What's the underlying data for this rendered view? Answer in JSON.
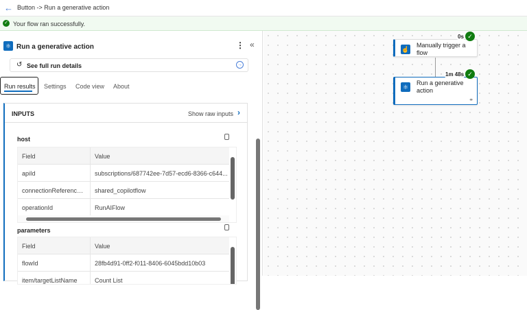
{
  "header": {
    "breadcrumb": "Button -> Run a generative action"
  },
  "banner": {
    "message": "Your flow ran successfully."
  },
  "panel": {
    "title": "Run a generative action",
    "details_label": "See full run details",
    "tabs": [
      "Run results",
      "Settings",
      "Code view",
      "About"
    ],
    "inputs": {
      "title": "INPUTS",
      "raw_label": "Show raw inputs",
      "sections": [
        {
          "name": "host",
          "headers": [
            "Field",
            "Value"
          ],
          "rows": [
            [
              "apiId",
              "subscriptions/687742ee-7d57-ecd6-8366-c644..."
            ],
            [
              "connectionReferenceN...",
              "shared_copilotflow"
            ],
            [
              "operationId",
              "RunAIFlow"
            ]
          ]
        },
        {
          "name": "parameters",
          "headers": [
            "Field",
            "Value"
          ],
          "rows": [
            [
              "flowId",
              "28fb4d91-0ff2-f011-8406-6045bdd10b03"
            ],
            [
              "item/targetListName",
              "Count List"
            ]
          ]
        }
      ]
    }
  },
  "canvas": {
    "nodes": [
      {
        "title": "Manually trigger a flow",
        "duration": "0s"
      },
      {
        "title": "Run a generative action",
        "duration": "1m 48s"
      }
    ]
  },
  "colors": {
    "accent": "#0f6cbd",
    "success": "#107c10"
  }
}
